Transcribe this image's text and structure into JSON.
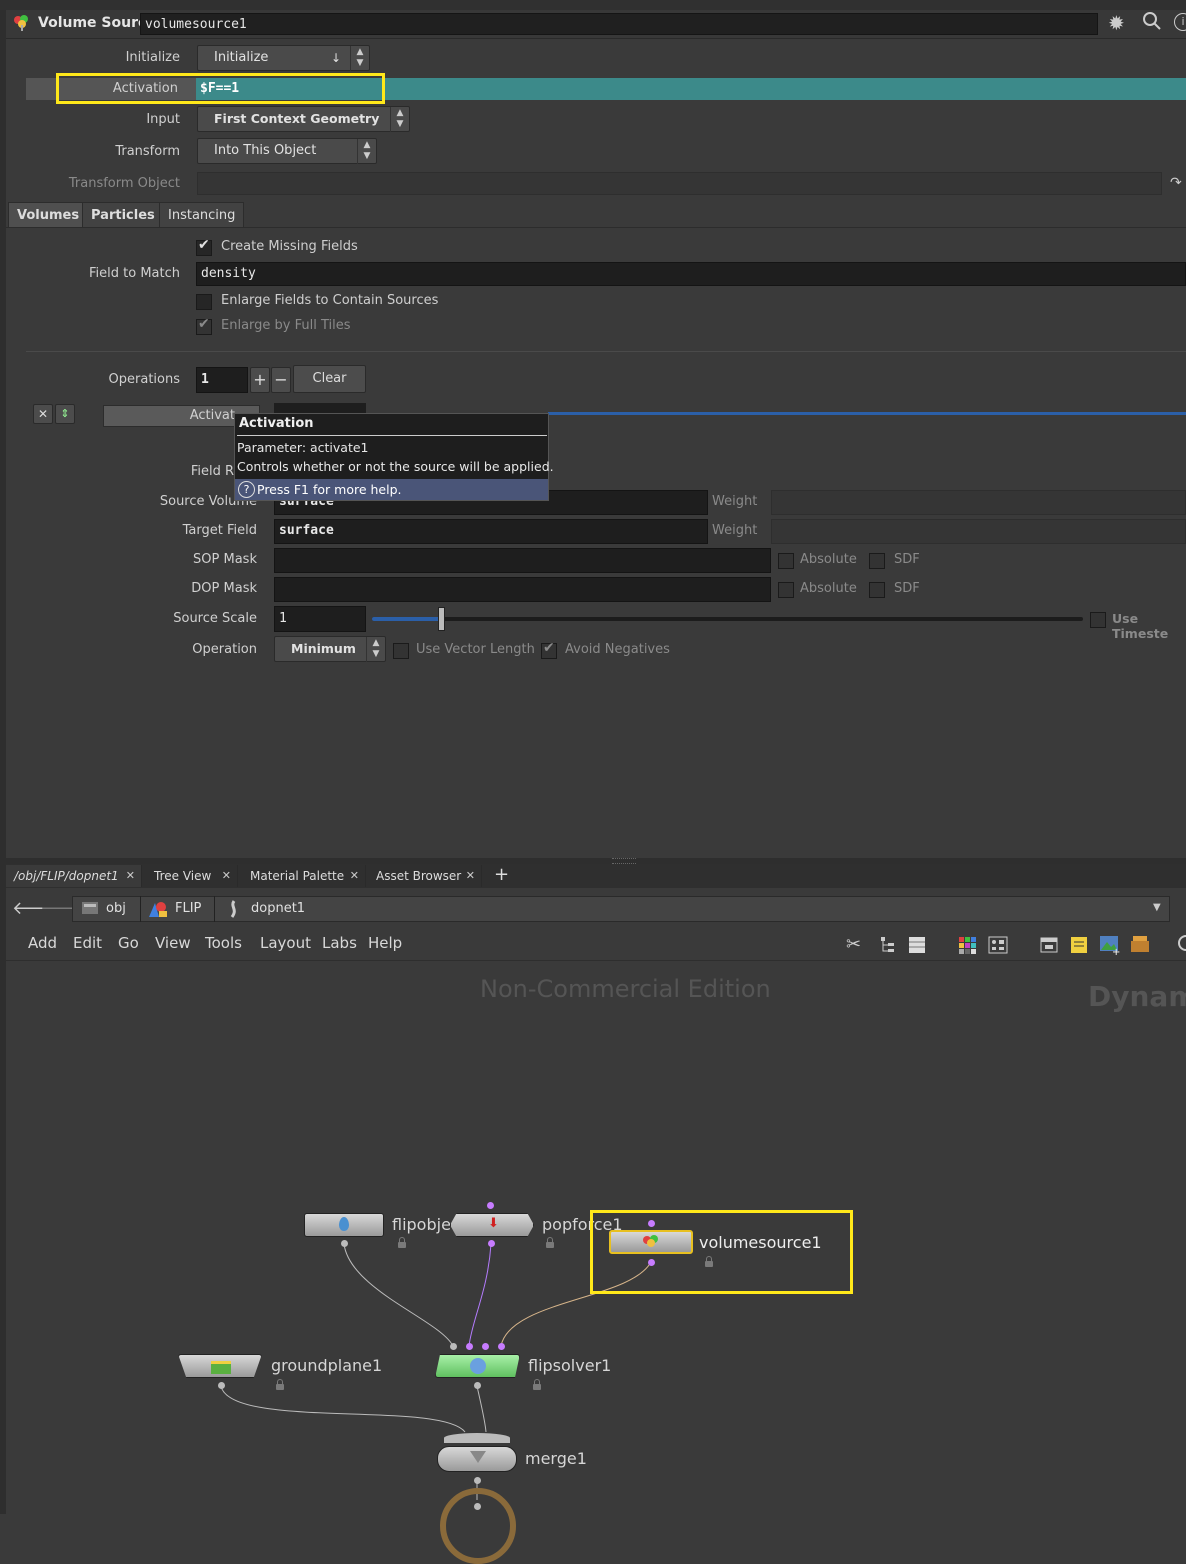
{
  "header": {
    "node_type": "Volume Source",
    "node_name": "volumesource1"
  },
  "params": {
    "initialize": {
      "label": "Initialize",
      "value": "Initialize"
    },
    "activation": {
      "label": "Activation",
      "value": "$F==1"
    },
    "input": {
      "label": "Input",
      "value": "First Context Geometry"
    },
    "transform": {
      "label": "Transform",
      "value": "Into This Object"
    },
    "transform_object": {
      "label": "Transform Object",
      "value": ""
    }
  },
  "tabs": [
    "Volumes",
    "Particles",
    "Instancing"
  ],
  "volumes": {
    "create_missing": {
      "label": "Create Missing Fields",
      "checked": true
    },
    "field_to_match": {
      "label": "Field to Match",
      "value": "density"
    },
    "enlarge_fields": {
      "label": "Enlarge Fields to Contain Sources",
      "checked": false
    },
    "enlarge_full_tiles": {
      "label": "Enlarge by Full Tiles",
      "checked": true
    },
    "operations": {
      "label": "Operations",
      "value": "1",
      "add": "+",
      "remove": "−",
      "clear": "Clear"
    },
    "op": {
      "activation_label": "Activat",
      "field_rank_label": "Field R",
      "source_volume": {
        "label": "Source Volume",
        "value": "surface",
        "weight": "Weight"
      },
      "target_field": {
        "label": "Target Field",
        "value": "surface",
        "weight": "Weight"
      },
      "sop_mask": {
        "label": "SOP Mask",
        "absolute": "Absolute",
        "sdf": "SDF"
      },
      "dop_mask": {
        "label": "DOP Mask",
        "absolute": "Absolute",
        "sdf": "SDF"
      },
      "source_scale": {
        "label": "Source Scale",
        "value": "1",
        "use_timestep": "Use Timeste"
      },
      "operation": {
        "label": "Operation",
        "value": "Minimum",
        "vector_length": "Use Vector Length",
        "avoid_negatives": "Avoid Negatives"
      }
    }
  },
  "tooltip": {
    "title": "Activation",
    "param": "Parameter: activate1",
    "desc": "Controls whether or not the source will be applied.",
    "help": "Press F1 for more help."
  },
  "pane_tabs": [
    "/obj/FLIP/dopnet1",
    "Tree View",
    "Material Palette",
    "Asset Browser"
  ],
  "pane_add": "+",
  "breadcrumb": [
    "obj",
    "FLIP",
    "dopnet1"
  ],
  "menu": [
    "Add",
    "Edit",
    "Go",
    "View",
    "Tools",
    "Layout",
    "Labs",
    "Help"
  ],
  "network": {
    "watermark": "Non-Commercial Edition",
    "context": "Dynam",
    "nodes": {
      "flipobject": "flipobje",
      "popforce": "popforce1",
      "volumesource": "volumesource1",
      "groundplane": "groundplane1",
      "flipsolver": "flipsolver1",
      "merge": "merge1"
    }
  },
  "colors": {
    "activation_bg": "#3c8a8a",
    "highlight": "#ffe81a",
    "solver_green": "#7fd67f",
    "wire_purple": "#b57cff"
  }
}
